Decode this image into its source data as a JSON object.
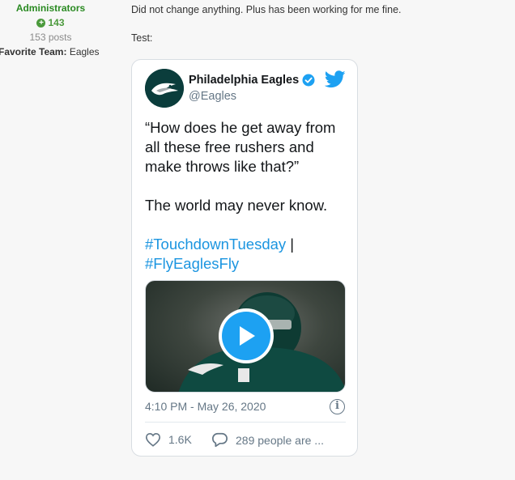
{
  "author": {
    "role": "Administrators",
    "reputation": "143",
    "posts": "153 posts",
    "favorite_team_label": "Favorite Team:",
    "favorite_team_value": "Eagles"
  },
  "post": {
    "line1": "Did not change anything.  Plus has been working for me fine.",
    "line2": "Test:"
  },
  "tweet": {
    "display_name": "Philadelphia Eagles",
    "handle": "@Eagles",
    "text_line1": "“How does he get away from all these free rushers and make throws like that?”",
    "text_line2": "The world may never know.",
    "hashtag1": "#TouchdownTuesday",
    "separator": " |",
    "hashtag2": "#FlyEaglesFly",
    "timestamp": "4:10 PM - May 26, 2020",
    "likes": "1.6K",
    "replies": "289 people are ..."
  },
  "colors": {
    "twitter_blue": "#1da1f2",
    "admin_green": "#2a8a22",
    "eagles_green": "#0b3d3c"
  },
  "icons": [
    "reputation-plus-icon",
    "verified-icon",
    "twitter-bird-icon",
    "play-icon",
    "info-icon",
    "heart-icon",
    "reply-bubble-icon"
  ]
}
